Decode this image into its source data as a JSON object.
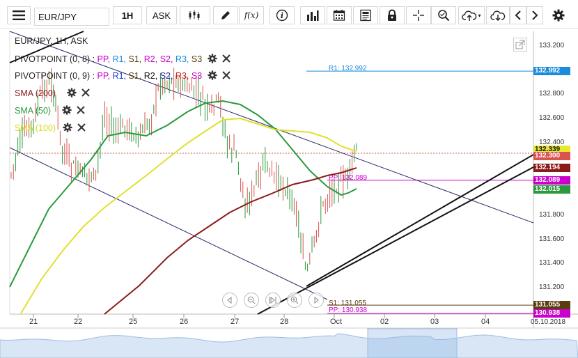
{
  "toolbar": {
    "symbol": "EUR/JPY",
    "timeframe": "1H",
    "price_type": "ASK",
    "icons": [
      "menu-icon",
      "candlestick-icon",
      "pencil-icon",
      "function-icon",
      "info-icon",
      "volume-bars-icon",
      "calendar-icon",
      "news-icon",
      "lock-icon",
      "crosshair-icon",
      "zoom-icon",
      "cloud-upload-icon",
      "cloud-download-icon",
      "chevron-left-icon",
      "chevron-right-icon",
      "settings-icon"
    ],
    "fx_label": "f(x)"
  },
  "legend": {
    "title": "EUR/JPY, 1H, ASK",
    "pivot1": {
      "name": "PIVOTPOINT (0, 8)",
      "sep": " : ",
      "items": [
        {
          "label": "PP,",
          "color": "#cc00cc"
        },
        {
          "label": "R1,",
          "color": "#1a8cdc"
        },
        {
          "label": "S1,",
          "color": "#5a3d0c"
        },
        {
          "label": "R2,",
          "color": "#cc00cc"
        },
        {
          "label": "S2,",
          "color": "#cc00cc"
        },
        {
          "label": "R3,",
          "color": "#1a8cdc"
        },
        {
          "label": "S3",
          "color": "#5a3d0c"
        }
      ]
    },
    "pivot2": {
      "name": "PIVOTPOINT (0, 9)",
      "sep": " : ",
      "items": [
        {
          "label": "PP,",
          "color": "#cc00cc"
        },
        {
          "label": "R1,",
          "color": "#1a3ccc"
        },
        {
          "label": "S1,",
          "color": "#5a3d0c"
        },
        {
          "label": "R2,",
          "color": "#111111"
        },
        {
          "label": "S2,",
          "color": "#2222aa"
        },
        {
          "label": "R3,",
          "color": "#cc2222"
        },
        {
          "label": "S3",
          "color": "#cc00cc"
        }
      ]
    },
    "sma200": {
      "label": "SMA (200)",
      "color": "#8b1a1a"
    },
    "sma50": {
      "label": "SMA (50)",
      "color": "#2a9a3a"
    },
    "sma100": {
      "label": "SMA (100)",
      "color": "#e0e030"
    }
  },
  "price_axis": {
    "ticks": [
      "133.200",
      "133.000",
      "132.800",
      "132.600",
      "132.400",
      "132.200",
      "132.000",
      "131.800",
      "131.600",
      "131.400",
      "131.200"
    ]
  },
  "price_labels": [
    {
      "text": "132.992",
      "color": "#1a8cdc"
    },
    {
      "text": "132.339",
      "color": "#e8e830",
      "text_color": "#111"
    },
    {
      "text": "132.300",
      "color": "#d9534f"
    },
    {
      "text": "132.194",
      "color": "#8b1a1a"
    },
    {
      "text": "132.089",
      "color": "#cc00cc"
    },
    {
      "text": "132.015",
      "color": "#2a9a3a"
    },
    {
      "text": "131.055",
      "color": "#5a3d0c"
    },
    {
      "text": "130.938",
      "color": "#cc00cc"
    }
  ],
  "line_labels": {
    "r1": "R1: 132.992",
    "pp_upper": "PP: 132.089",
    "s1": "S1: 131.055",
    "pp_lower": "PP: 130.938"
  },
  "time_axis": {
    "ticks": [
      "21",
      "22",
      "25",
      "26",
      "27",
      "28",
      "Oct",
      "02",
      "03",
      "04"
    ],
    "last_date": "05.10.2018"
  },
  "nav_buttons": [
    "scroll-left-icon",
    "zoom-out-icon",
    "reset-icon",
    "zoom-in-icon",
    "scroll-right-icon"
  ]
}
